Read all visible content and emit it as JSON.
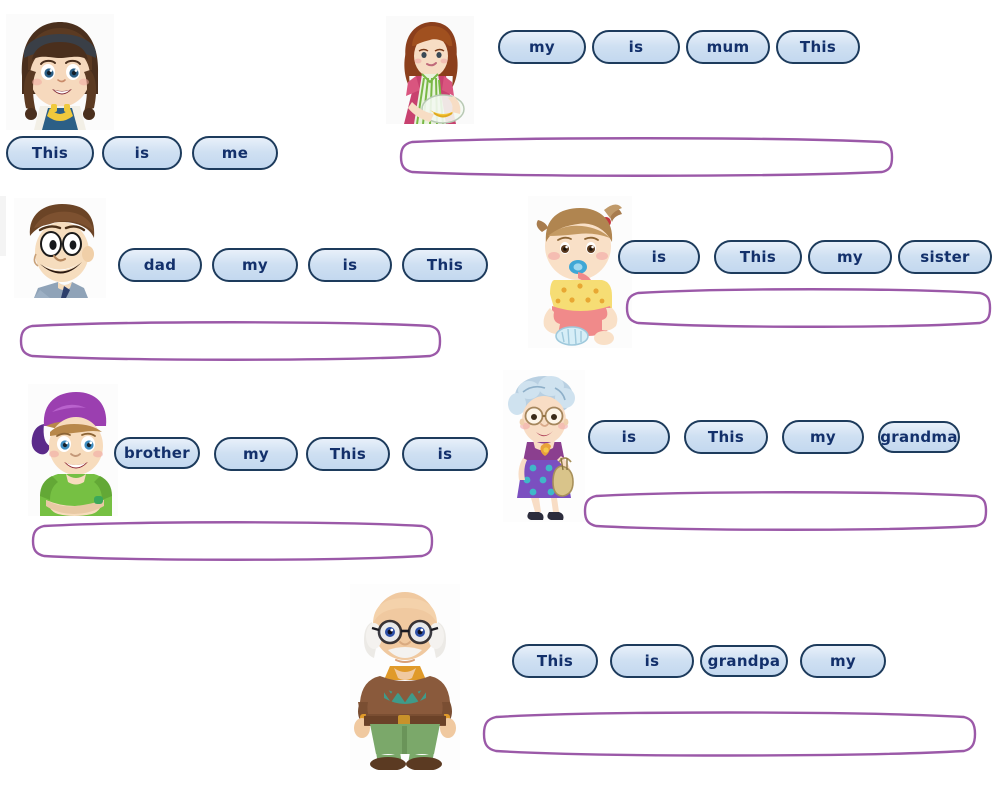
{
  "worksheet": {
    "title": "Family members sentence scramble worksheet",
    "tile_fill": "#cfe0f2",
    "tile_border": "#1d3b5c",
    "tile_text_color": "#13306b",
    "answer_line_color": "#9b59a8",
    "background": "#ffffff"
  },
  "rows": [
    {
      "id": "me",
      "figure": "girl-avatar",
      "tiles": [
        {
          "label": "This"
        },
        {
          "label": "is"
        },
        {
          "label": "me"
        }
      ],
      "answer_value": ""
    },
    {
      "id": "mum",
      "figure": "mum-avatar",
      "tiles": [
        {
          "label": "my"
        },
        {
          "label": "is"
        },
        {
          "label": "mum"
        },
        {
          "label": "This"
        }
      ],
      "answer_value": ""
    },
    {
      "id": "dad",
      "figure": "dad-avatar",
      "tiles": [
        {
          "label": "dad"
        },
        {
          "label": "my"
        },
        {
          "label": "is"
        },
        {
          "label": "This"
        }
      ],
      "answer_value": ""
    },
    {
      "id": "sister",
      "figure": "sister-avatar",
      "tiles": [
        {
          "label": "is"
        },
        {
          "label": "This"
        },
        {
          "label": "my"
        },
        {
          "label": "sister"
        }
      ],
      "answer_value": ""
    },
    {
      "id": "brother",
      "figure": "brother-avatar",
      "tiles": [
        {
          "label": "brother"
        },
        {
          "label": "my"
        },
        {
          "label": "This"
        },
        {
          "label": "is"
        }
      ],
      "answer_value": ""
    },
    {
      "id": "grandma",
      "figure": "grandma-avatar",
      "tiles": [
        {
          "label": "is"
        },
        {
          "label": "This"
        },
        {
          "label": "my"
        },
        {
          "label": "grandma"
        }
      ],
      "answer_value": ""
    },
    {
      "id": "grandpa",
      "figure": "grandpa-avatar",
      "tiles": [
        {
          "label": "This"
        },
        {
          "label": "is"
        },
        {
          "label": "grandpa"
        },
        {
          "label": "my"
        }
      ],
      "answer_value": ""
    }
  ]
}
